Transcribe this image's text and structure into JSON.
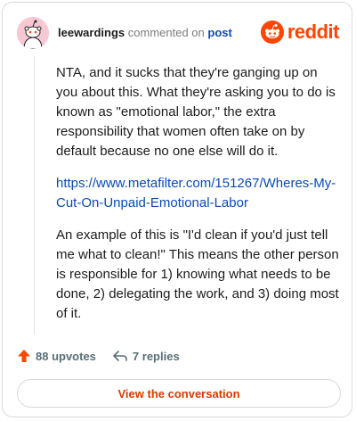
{
  "header": {
    "username": "leewardings",
    "action_text": "commented on",
    "post_label": "post",
    "brand_text": "reddit"
  },
  "comment": {
    "paragraph_1": "NTA, and it sucks that they're ganging up on you about this. What they're asking you to do is known as \"emotional labor,\" the extra responsibility that women often take on by default because no one else will do it.",
    "link": "https://www.metafilter.com/151267/Wheres-My-Cut-On-Unpaid-Emotional-Labor",
    "paragraph_2": "An example of this is \"I'd clean if you'd just tell me what to clean!\" This means the other person is responsible for 1) knowing what needs to be done, 2) delegating the work, and 3) doing most of it."
  },
  "actions": {
    "upvotes_label": "88 upvotes",
    "replies_label": "7 replies"
  },
  "footer": {
    "button_label": "View the conversation"
  },
  "colors": {
    "brand": "#ff4500",
    "link": "#0a4ab5",
    "button_text": "#d93a00"
  }
}
